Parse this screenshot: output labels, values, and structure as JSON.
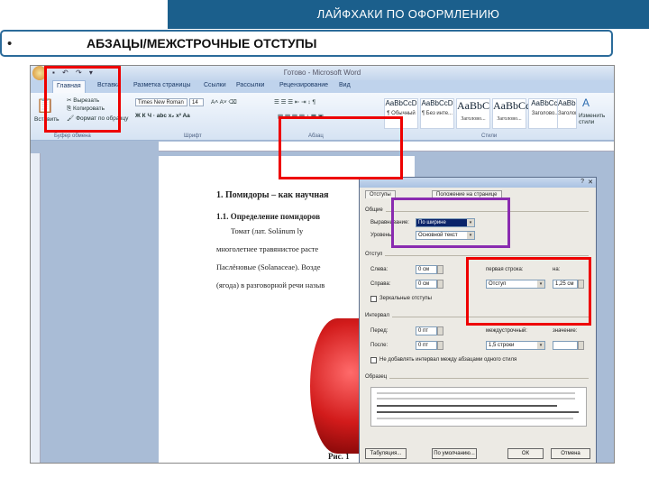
{
  "slide": {
    "title": "ЛАЙФХАКИ ПО ОФОРМЛЕНИЮ",
    "bullet": "•",
    "subtitle": "АБЗАЦЫ/МЕЖСТРОЧНЫЕ ОТСТУПЫ"
  },
  "word": {
    "window_title": "Готово - Microsoft Word",
    "tabs": [
      "Главная",
      "Вставка",
      "Разметка страницы",
      "Ссылки",
      "Рассылки",
      "Рецензирование",
      "Вид"
    ],
    "clipboard": {
      "paste": "Вставить",
      "cut": "Вырезать",
      "copy": "Копировать",
      "format_painter": "Формат по образцу",
      "group": "Буфер обмена"
    },
    "font": {
      "name": "Times New Roman",
      "size": "14",
      "group": "Шрифт"
    },
    "paragraph_group": "Абзац",
    "styles_group": "Стили",
    "styles": [
      {
        "sample": "AaBbCcD",
        "name": "¶ Обычный"
      },
      {
        "sample": "AaBbCcD",
        "name": "¶ Без инте..."
      },
      {
        "sample": "AaBbC",
        "name": "Заголово..."
      },
      {
        "sample": "AaBbCc",
        "name": "Заголово..."
      },
      {
        "sample": "AaBbCcI",
        "name": "Заголово..."
      },
      {
        "sample": "AaBbCcI",
        "name": "Заголово..."
      }
    ],
    "change_styles": "Изменить стили",
    "doc": {
      "heading": "1. Помидоры – как научная",
      "subheading": "1.1. Определение помидоров",
      "line1": "Томат   (лат. Solánum  ly",
      "line2": "многолетнее  травянистое  расте",
      "line3": "Паслёновые (Solanaceae). Возде",
      "line4": "(ягода) в разговорной речи назыв",
      "caption": "Рис. 1"
    },
    "dialog": {
      "tab1": "Отступы",
      "tab2": "Положение на странице",
      "general": "Общие",
      "alignment_label": "Выравнивание:",
      "alignment_value": "По ширине",
      "level_label": "Уровень:",
      "level_value": "Основной текст",
      "indent": "Отступ",
      "left_label": "Слева:",
      "left_value": "0 см",
      "right_label": "Справа:",
      "right_value": "0 см",
      "first_line_label": "первая строка:",
      "first_line_value": "Отступ",
      "by_label": "на:",
      "by_value": "1,25 см",
      "mirror": "Зеркальные отступы",
      "spacing": "Интервал",
      "before_label": "Перед:",
      "before_value": "0 пт",
      "after_label": "После:",
      "after_value": "0 пт",
      "line_spacing_label": "междустрочный:",
      "line_spacing_value": "1,5 строки",
      "at_label": "значение:",
      "at_value": "",
      "no_space": "Не добавлять интервал между абзацами одного стиля",
      "sample": "Образец",
      "btn_tabs": "Табуляция...",
      "btn_default": "По умолчанию...",
      "btn_ok": "ОК",
      "btn_cancel": "Отмена"
    }
  },
  "colors": {
    "title_bar": "#1b5f8c",
    "highlight_red": "#e00000",
    "highlight_purple": "#8a2bb0"
  }
}
